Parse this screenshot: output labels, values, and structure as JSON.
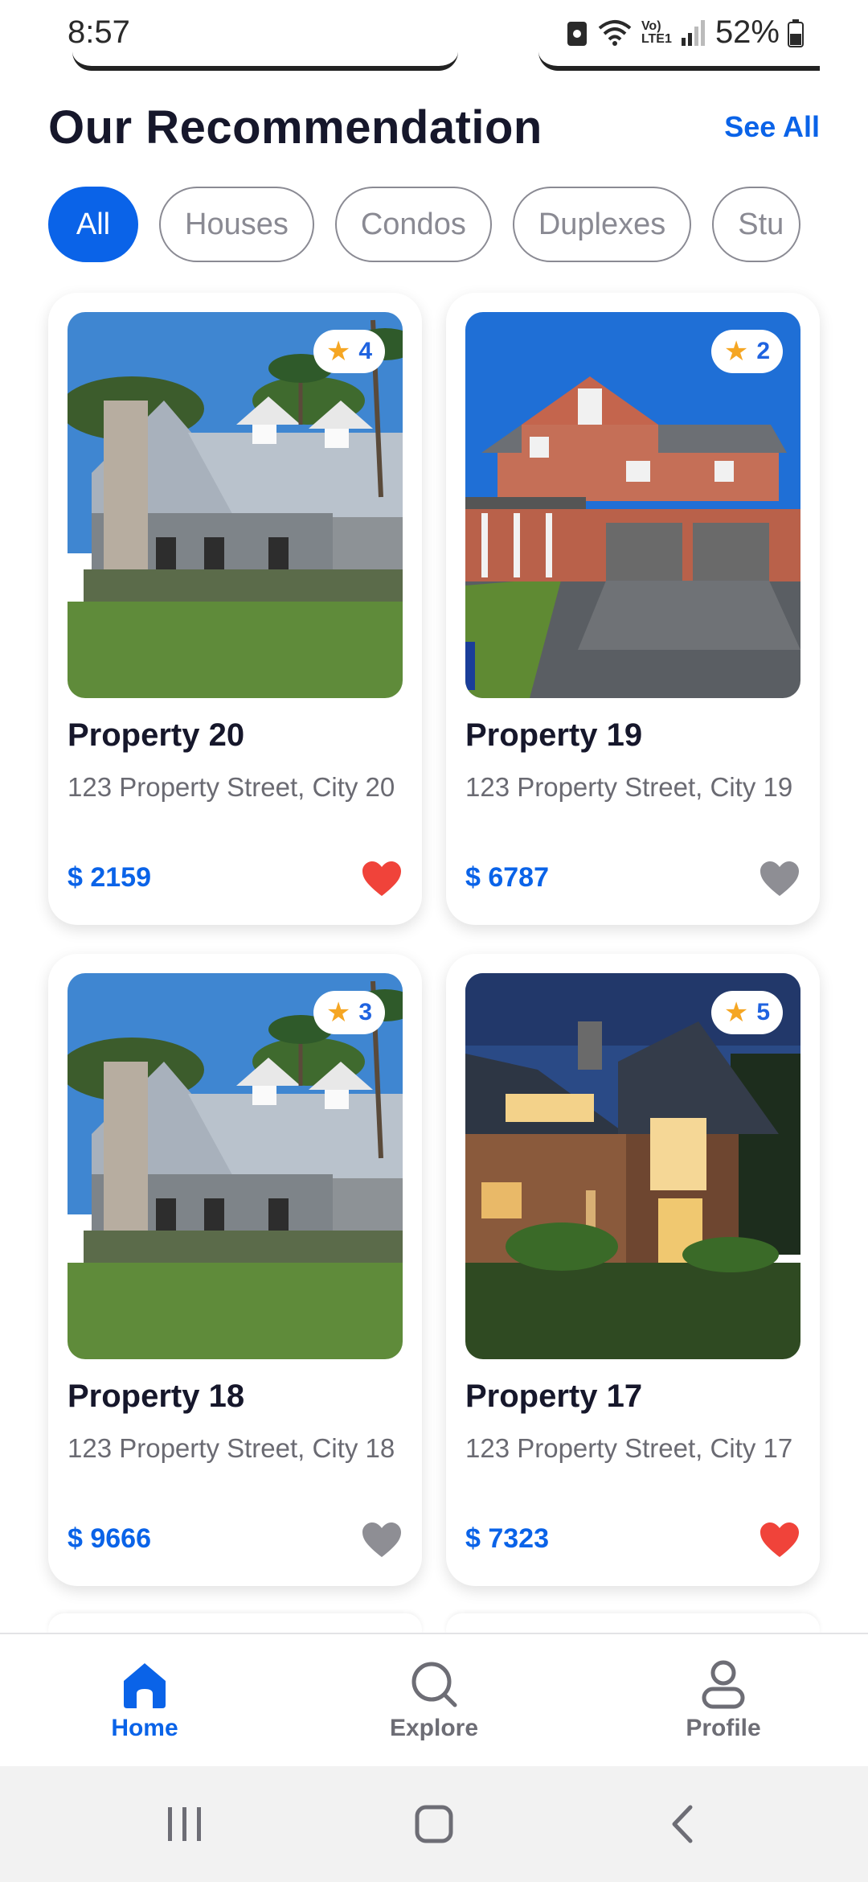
{
  "status": {
    "time": "8:57",
    "battery": "52%",
    "network": "Vo) LTE1"
  },
  "section": {
    "title": "Our Recommendation",
    "see_all": "See All"
  },
  "filters": [
    {
      "label": "All",
      "active": true
    },
    {
      "label": "Houses",
      "active": false
    },
    {
      "label": "Condos",
      "active": false
    },
    {
      "label": "Duplexes",
      "active": false
    },
    {
      "label": "Stu",
      "active": false
    }
  ],
  "properties": [
    {
      "name": "Property 20",
      "address": "123 Property Street, City 20",
      "price": "$ 2159",
      "rating": "4",
      "favorite": true,
      "image": "gray-farmhouse"
    },
    {
      "name": "Property 19",
      "address": "123 Property Street, City 19",
      "price": "$ 6787",
      "rating": "2",
      "favorite": false,
      "image": "brick-two-story"
    },
    {
      "name": "Property 18",
      "address": "123 Property Street, City 18",
      "price": "$ 9666",
      "rating": "3",
      "favorite": false,
      "image": "gray-farmhouse"
    },
    {
      "name": "Property 17",
      "address": "123 Property Street, City 17",
      "price": "$ 7323",
      "rating": "5",
      "favorite": true,
      "image": "modern-house-dusk"
    }
  ],
  "nav": {
    "home": "Home",
    "explore": "Explore",
    "profile": "Profile"
  },
  "colors": {
    "accent": "#0a63e8",
    "heart_active": "#f0433a",
    "heart_inactive": "#8e8e94",
    "star": "#f5a623"
  }
}
